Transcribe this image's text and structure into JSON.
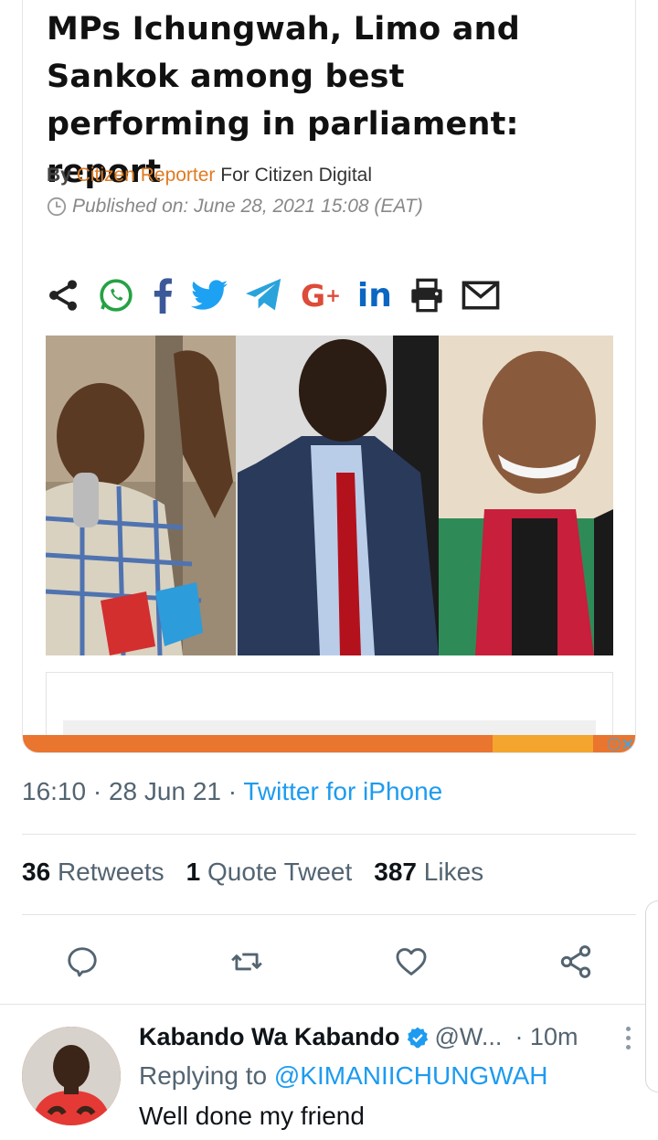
{
  "article": {
    "headline": "MPs Ichungwah, Limo and Sankok among best performing in parliament: report",
    "by_label": "By",
    "author": "Citizen Reporter",
    "outlet": "For Citizen Digital",
    "published": "Published on:  June 28, 2021 15:08 (EAT)",
    "share_icons": [
      "share-icon",
      "whatsapp-icon",
      "facebook-icon",
      "twitter-icon",
      "telegram-icon",
      "google-plus-icon",
      "linkedin-icon",
      "print-icon",
      "email-icon"
    ],
    "gplus_text": "G",
    "gplus_sup": "+",
    "linkedin_text": "in",
    "photo_description_icon": "article-photo",
    "adchoice_label": "i"
  },
  "tweet": {
    "time": "16:10",
    "date": "28 Jun 21",
    "separator": "·",
    "source": "Twitter for iPhone",
    "stats": [
      {
        "count": "36",
        "label": "Retweets"
      },
      {
        "count": "1",
        "label": "Quote Tweet"
      },
      {
        "count": "387",
        "label": "Likes"
      }
    ],
    "actions": [
      "reply-icon",
      "retweet-icon",
      "like-icon",
      "share-icon"
    ]
  },
  "reply": {
    "name": "Kabando Wa Kabando",
    "handle": "@W...",
    "time": "· 10m",
    "replying_prefix": "Replying to",
    "replying_to": "@KIMANIICHUNGWAH",
    "text": "Well done my friend"
  },
  "colors": {
    "twitter_blue": "#1d9bf0",
    "secondary_text": "#536471",
    "author_orange": "#e07b22",
    "ad_bar_orange": "#e9752f"
  }
}
